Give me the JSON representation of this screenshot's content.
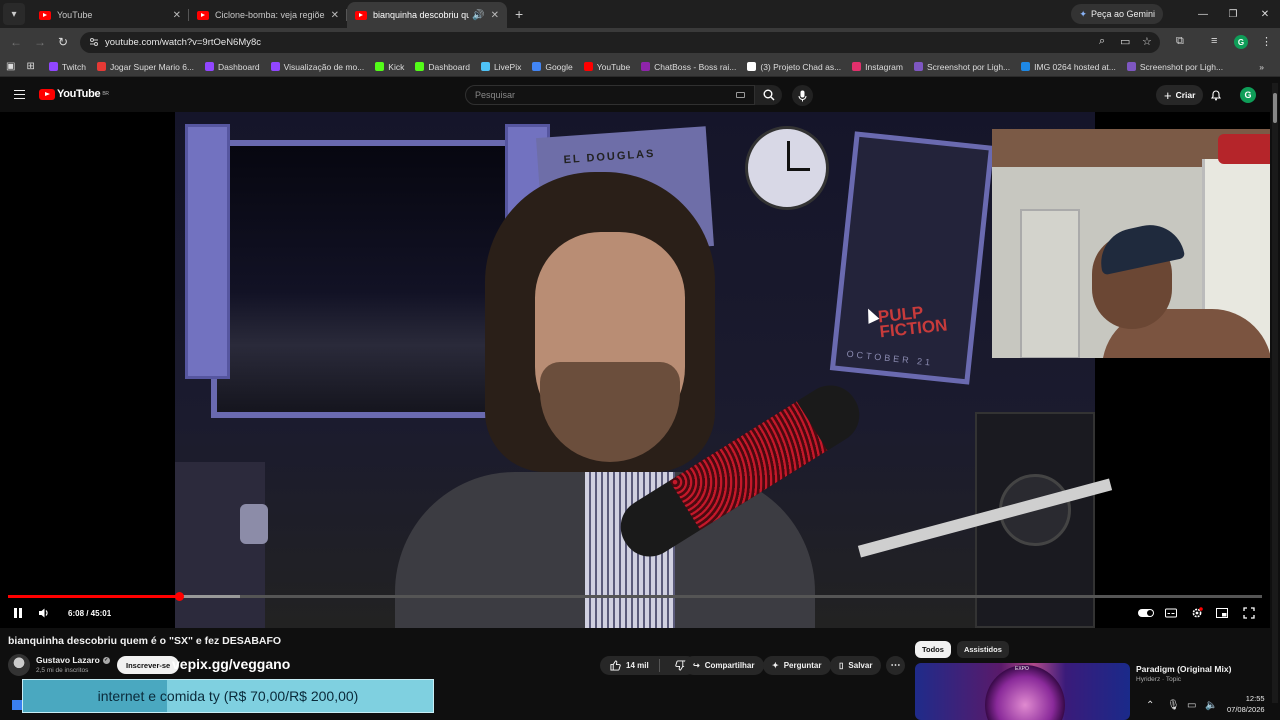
{
  "browser": {
    "tabs": [
      {
        "label": "YouTube",
        "active": false
      },
      {
        "label": "Ciclone-bomba: veja regiões qu",
        "active": false
      },
      {
        "label": "bianquinha descobriu quem",
        "active": true
      }
    ],
    "gemini_label": "Peça ao Gemini",
    "url": "youtube.com/watch?v=9rtOeN6My8c",
    "profile_initial": "G",
    "bookmarks": [
      {
        "label": "Twitch",
        "color": "#9146ff"
      },
      {
        "label": "Jogar Super Mario 6...",
        "color": "#e53935"
      },
      {
        "label": "Dashboard",
        "color": "#9146ff"
      },
      {
        "label": "Visualização de mo...",
        "color": "#9146ff"
      },
      {
        "label": "Kick",
        "color": "#53fc18"
      },
      {
        "label": "Dashboard",
        "color": "#53fc18"
      },
      {
        "label": "LivePix",
        "color": "#4fc3f7"
      },
      {
        "label": "Google",
        "color": "#4285f4"
      },
      {
        "label": "YouTube",
        "color": "#ff0000"
      },
      {
        "label": "ChatBoss - Boss rai...",
        "color": "#8e24aa"
      },
      {
        "label": "(3) Projeto Chad as...",
        "color": "#ffffff"
      },
      {
        "label": "Instagram",
        "color": "#e1306c"
      },
      {
        "label": "Screenshot por Ligh...",
        "color": "#7e57c2"
      },
      {
        "label": "IMG 0264 hosted at...",
        "color": "#1e88e5"
      },
      {
        "label": "Screenshot por Ligh...",
        "color": "#7e57c2"
      }
    ]
  },
  "youtube": {
    "logo_text": "YouTube",
    "logo_region": "BR",
    "search_placeholder": "Pesquisar",
    "create_label": "Criar",
    "avatar_initial": "G"
  },
  "player": {
    "current_time": "6:08",
    "duration": "45:01",
    "time_display": "6:08 / 45:01",
    "played_fraction": 0.136,
    "buffered_fraction": 0.185,
    "scene_text": {
      "poster1": "EL DOUGLAS",
      "poster2_title": "PULP FICTION",
      "poster2_date": "OCTOBER 21"
    }
  },
  "video": {
    "title": "bianquinha descobriu quem é o \"SX\" e fez DESABAFO",
    "channel": "Gustavo Lazaro",
    "subscribers": "2,5 mi de inscritos",
    "subscribe_label": "Inscrever-se",
    "overlay_link": "vepix.gg/veggano",
    "likes": "14 mil",
    "share_label": "Compartilhar",
    "ask_label": "Perguntar",
    "save_label": "Salvar"
  },
  "related": {
    "chips": [
      {
        "label": "Todos",
        "selected": true
      },
      {
        "label": "Assistidos",
        "selected": false
      }
    ],
    "item": {
      "title": "Paradigm (Original Mix)",
      "artist": "Hyriderz · Topic",
      "thumb_text": "EXPO"
    }
  },
  "donation": {
    "text": "internet e comida ty (R$ 70,00/R$ 200,00)",
    "progress_fraction": 0.35
  },
  "taskbar": {
    "time": "12:55",
    "date": "07/08/2026"
  }
}
